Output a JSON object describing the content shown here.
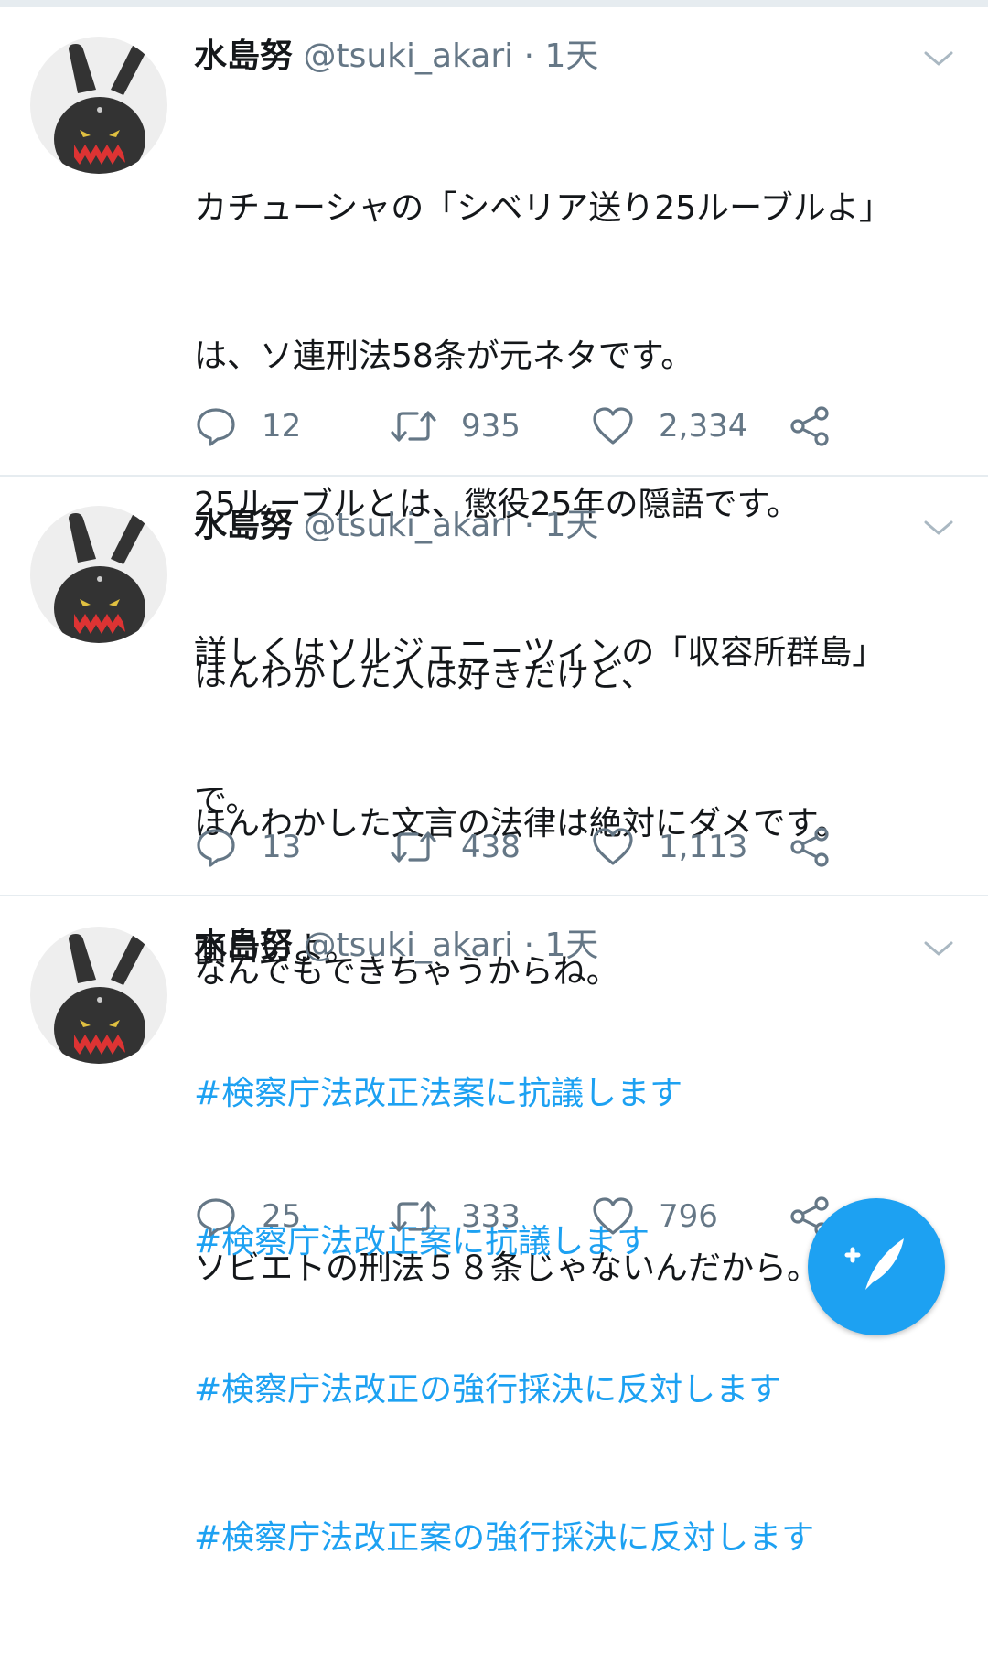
{
  "colors": {
    "accent": "#1da1f2",
    "secondary_text": "#657786",
    "divider": "#e6ecf0"
  },
  "tweets": [
    {
      "author": {
        "name": "水島努",
        "handle": "@tsuki_akari",
        "separator": "·",
        "time": "1天"
      },
      "lines": [
        "カチューシャの「シベリア送り25ルーブルよ」",
        "は、ソ連刑法58条が元ネタです。",
        "25ルーブルとは、懲役25年の隠語です。",
        "詳しくはソルジェニーツィンの「収容所群島」",
        "で。",
        "面白いよ。"
      ],
      "stats": {
        "replies": "12",
        "retweets": "935",
        "likes": "2,334"
      }
    },
    {
      "author": {
        "name": "水島努",
        "handle": "@tsuki_akari",
        "separator": "·",
        "time": "1天"
      },
      "lines": [
        "ほんわかした人は好きだけど、",
        "ほんわかした文言の法律は絶対にダメです。",
        "なんでもできちゃうからね。",
        "",
        "ソビエトの刑法５８条じゃないんだから。"
      ],
      "stats": {
        "replies": "13",
        "retweets": "438",
        "likes": "1,113"
      }
    },
    {
      "author": {
        "name": "水島努",
        "handle": "@tsuki_akari",
        "separator": "·",
        "time": "1天"
      },
      "lines": [
        "#検察庁法改正法案に抗議します",
        "#検察庁法改正案に抗議します",
        "#検察庁法改正の強行採決に反対します",
        "#検察庁法改正案の強行採決に反対します"
      ],
      "stats": {
        "replies": "25",
        "retweets": "333",
        "likes": "796"
      }
    }
  ],
  "icons": {
    "reply": "reply-icon",
    "retweet": "retweet-icon",
    "like": "heart-icon",
    "share": "share-icon",
    "caret": "chevron-down-icon",
    "compose": "compose-tweet-icon"
  }
}
